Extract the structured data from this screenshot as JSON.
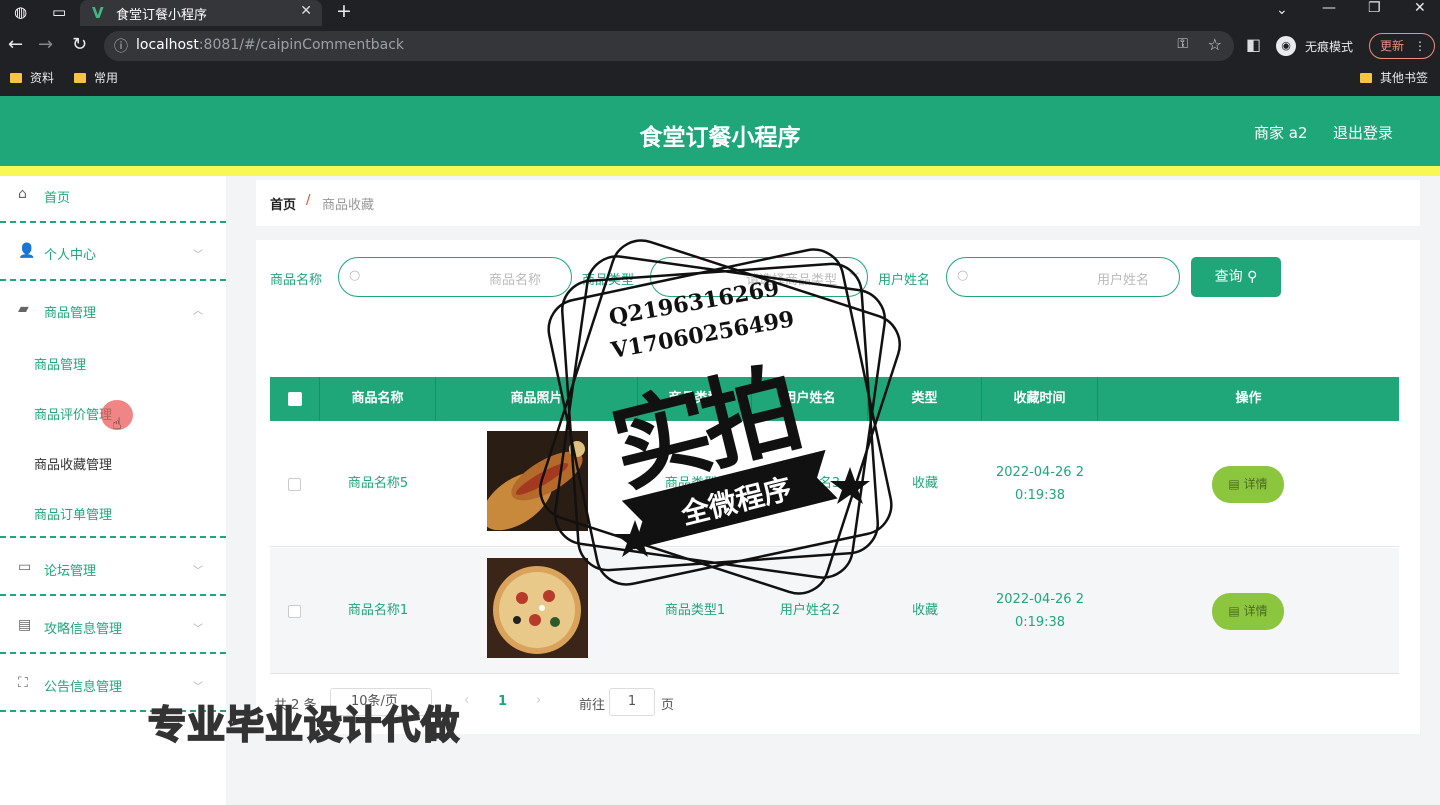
{
  "browser": {
    "tab_title": "食堂订餐小程序",
    "url_host": "localhost",
    "url_rest": ":8081/#/caipinCommentback",
    "incognito_label": "无痕模式",
    "update_label": "更新",
    "bookmarks": [
      "资料",
      "常用"
    ],
    "other_bookmarks": "其他书签"
  },
  "header": {
    "title": "食堂订餐小程序",
    "user": "商家 a2",
    "logout": "退出登录"
  },
  "sidebar": {
    "items": [
      {
        "label": "首页",
        "icon": "home-icon"
      },
      {
        "label": "个人中心",
        "icon": "user-icon"
      },
      {
        "label": "商品管理",
        "icon": "briefcase-icon"
      },
      {
        "label": "论坛管理",
        "icon": "forum-icon"
      },
      {
        "label": "攻略信息管理",
        "icon": "clipboard-icon"
      },
      {
        "label": "公告信息管理",
        "icon": "frame-icon"
      }
    ],
    "sub_items": [
      "商品管理",
      "商品评价管理",
      "商品收藏管理",
      "商品订单管理"
    ]
  },
  "breadcrumb": {
    "home": "首页",
    "separator": "/",
    "current": "商品收藏"
  },
  "filters": {
    "name_label": "商品名称",
    "name_placeholder": "商品名称",
    "type_label": "商品类型",
    "type_placeholder": "请选择商品类型",
    "user_label": "用户姓名",
    "user_placeholder": "用户姓名",
    "query_button": "查询"
  },
  "table": {
    "columns": [
      "商品名称",
      "商品照片",
      "商品类型",
      "用户姓名",
      "类型",
      "收藏时间",
      "操作"
    ],
    "rows": [
      {
        "name": "商品名称5",
        "type": "商品类型3",
        "user": "用户姓名3",
        "kind": "收藏",
        "time_line1": "2022-04-26 2",
        "time_line2": "0:19:38",
        "action": "详情"
      },
      {
        "name": "商品名称1",
        "type": "商品类型1",
        "user": "用户姓名2",
        "kind": "收藏",
        "time_line1": "2022-04-26 2",
        "time_line2": "0:19:38",
        "action": "详情"
      }
    ]
  },
  "pagination": {
    "total": "共 2 条",
    "page_size": "10条/页",
    "current_page": "1",
    "goto_label": "前往",
    "goto_value": "1",
    "page_suffix": "页"
  },
  "watermark": {
    "qq": "Q2196316269",
    "vx": "V17060256499",
    "big": "实拍",
    "ribbon": "全微程序",
    "bottom": "专业毕业设计代做"
  }
}
